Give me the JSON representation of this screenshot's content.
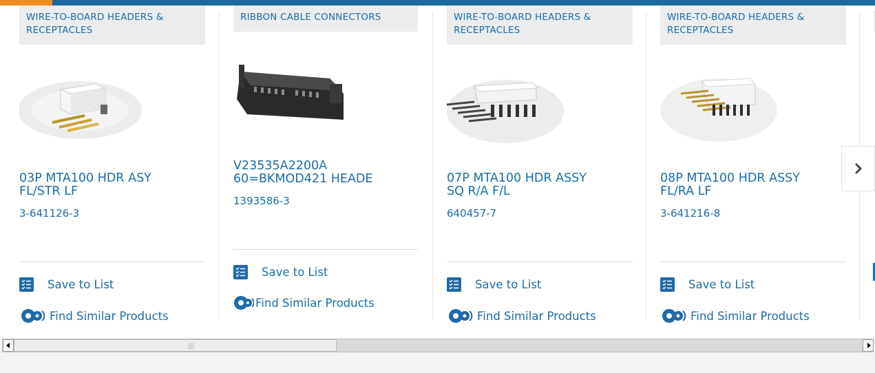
{
  "products": [
    {
      "category": "WIRE-TO-BOARD HEADERS & RECEPTACLES",
      "title_line1": "03P MTA100 HDR ASY",
      "title_line2": "FL/STR LF",
      "part_number": "3-641126-3"
    },
    {
      "category": "RIBBON CABLE CONNECTORS",
      "title_line1": "V23535A2200A",
      "title_line2": "60=BKMOD421 HEADE",
      "part_number": "1393586-3"
    },
    {
      "category": "WIRE-TO-BOARD HEADERS & RECEPTACLES",
      "title_line1": "07P MTA100 HDR ASSY",
      "title_line2": "SQ R/A F/L",
      "part_number": "640457-7"
    },
    {
      "category": "WIRE-TO-BOARD HEADERS & RECEPTACLES",
      "title_line1": "08P MTA100 HDR ASSY",
      "title_line2": "FL/RA LF",
      "part_number": "3-641216-8"
    }
  ],
  "actions": {
    "save_label": "Save to List",
    "similar_label": "Find Similar Products"
  },
  "icons": {
    "save": "checklist-icon",
    "similar": "gears-icon",
    "next": "chevron-right-icon"
  },
  "colors": {
    "link": "#1b6da6",
    "accent_orange": "#f08c1c",
    "accent_blue": "#1a6aa0"
  }
}
